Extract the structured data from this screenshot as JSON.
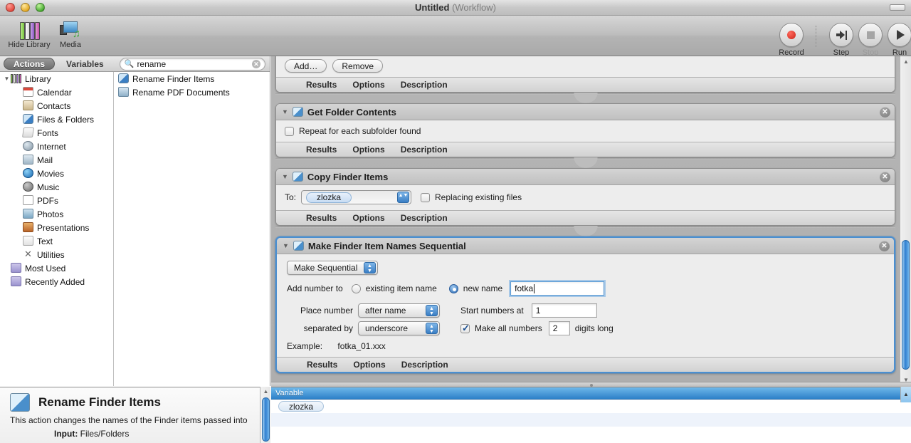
{
  "window": {
    "title": "Untitled",
    "subtitle": "(Workflow)"
  },
  "toolbar": {
    "hide_library_label": "Hide Library",
    "media_label": "Media",
    "record_label": "Record",
    "step_label": "Step",
    "stop_label": "Stop",
    "run_label": "Run"
  },
  "left_panel": {
    "tabs": [
      {
        "label": "Actions",
        "selected": true
      },
      {
        "label": "Variables",
        "selected": false
      }
    ],
    "search": {
      "value": "rename",
      "placeholder": "Search"
    },
    "library": [
      {
        "label": "Library",
        "level": 0,
        "icon": "library-icon",
        "expanded": true
      },
      {
        "label": "Calendar",
        "level": 1,
        "icon": "calendar-icon"
      },
      {
        "label": "Contacts",
        "level": 1,
        "icon": "contacts-icon"
      },
      {
        "label": "Files & Folders",
        "level": 1,
        "icon": "finder-icon"
      },
      {
        "label": "Fonts",
        "level": 1,
        "icon": "fonts-icon"
      },
      {
        "label": "Internet",
        "level": 1,
        "icon": "internet-icon"
      },
      {
        "label": "Mail",
        "level": 1,
        "icon": "mail-icon"
      },
      {
        "label": "Movies",
        "level": 1,
        "icon": "movies-icon"
      },
      {
        "label": "Music",
        "level": 1,
        "icon": "music-icon"
      },
      {
        "label": "PDFs",
        "level": 1,
        "icon": "pdf-icon"
      },
      {
        "label": "Photos",
        "level": 1,
        "icon": "photos-icon"
      },
      {
        "label": "Presentations",
        "level": 1,
        "icon": "presentations-icon"
      },
      {
        "label": "Text",
        "level": 1,
        "icon": "text-icon"
      },
      {
        "label": "Utilities",
        "level": 1,
        "icon": "utilities-icon"
      },
      {
        "label": "Most Used",
        "level": 2,
        "icon": "folder-icon"
      },
      {
        "label": "Recently Added",
        "level": 2,
        "icon": "folder-icon"
      }
    ],
    "actions": [
      {
        "label": "Rename Finder Items",
        "icon": "finder-icon"
      },
      {
        "label": "Rename PDF Documents",
        "icon": "pdf-doc-icon"
      }
    ]
  },
  "description": {
    "title": "Rename Finder Items",
    "body": "This action changes the names of the Finder items passed into",
    "input_label": "Input:",
    "input_value": "Files/Folders"
  },
  "workflow": {
    "top_action": {
      "add_label": "Add…",
      "remove_label": "Remove",
      "footer": [
        "Results",
        "Options",
        "Description"
      ]
    },
    "actions": [
      {
        "title": "Get Folder Contents",
        "icon": "finder-icon",
        "selected": false,
        "checkbox_label": "Repeat for each subfolder found",
        "checkbox_checked": false,
        "footer": [
          "Results",
          "Options",
          "Description"
        ]
      },
      {
        "title": "Copy Finder Items",
        "icon": "finder-icon",
        "selected": false,
        "to_label": "To:",
        "to_value": "zlozka",
        "replacing_label": "Replacing existing files",
        "replacing_checked": false,
        "footer": [
          "Results",
          "Options",
          "Description"
        ]
      },
      {
        "title": "Make Finder Item Names Sequential",
        "icon": "finder-icon",
        "selected": true,
        "mode_popup": "Make Sequential",
        "add_number_to_label": "Add number to",
        "existing_item_name_label": "existing item name",
        "existing_selected": false,
        "new_name_label": "new name",
        "new_name_selected": true,
        "new_name_value": "fotka",
        "place_number_label": "Place number",
        "place_number_value": "after name",
        "separated_by_label": "separated by",
        "separated_by_value": "underscore",
        "start_numbers_at_label": "Start numbers at",
        "start_numbers_at_value": "1",
        "make_all_numbers_label": "Make all numbers",
        "make_all_numbers_checked": true,
        "digits_value": "2",
        "digits_long_label": "digits long",
        "example_label": "Example:",
        "example_value": "fotka_01.xxx",
        "footer": [
          "Results",
          "Options",
          "Description"
        ]
      }
    ]
  },
  "variables_panel": {
    "column_header": "Variable",
    "rows": [
      {
        "name": "zlozka"
      }
    ]
  },
  "colors": {
    "accent": "#2d80c8",
    "selection_border": "#4b8fd0",
    "record_red": "#cc2418"
  }
}
